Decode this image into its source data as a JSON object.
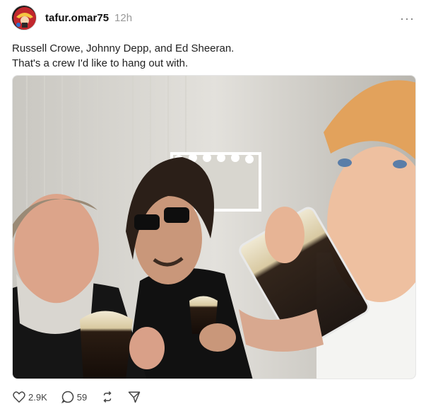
{
  "post": {
    "username": "tafur.omar75",
    "timestamp": "12h",
    "more_label": "···",
    "caption_lines": [
      "Russell Crowe, Johnny Depp, and Ed Sheeran.",
      "That's a crew I'd like to hang out with."
    ],
    "likes_count": "2.9K",
    "replies_count": "59"
  },
  "icons": {
    "avatar": "profile-avatar",
    "like": "heart-icon",
    "reply": "comment-icon",
    "repost": "repost-icon",
    "share": "send-icon"
  },
  "colors": {
    "text": "#101010",
    "muted": "#999999",
    "divider": "#e6e6e6"
  }
}
